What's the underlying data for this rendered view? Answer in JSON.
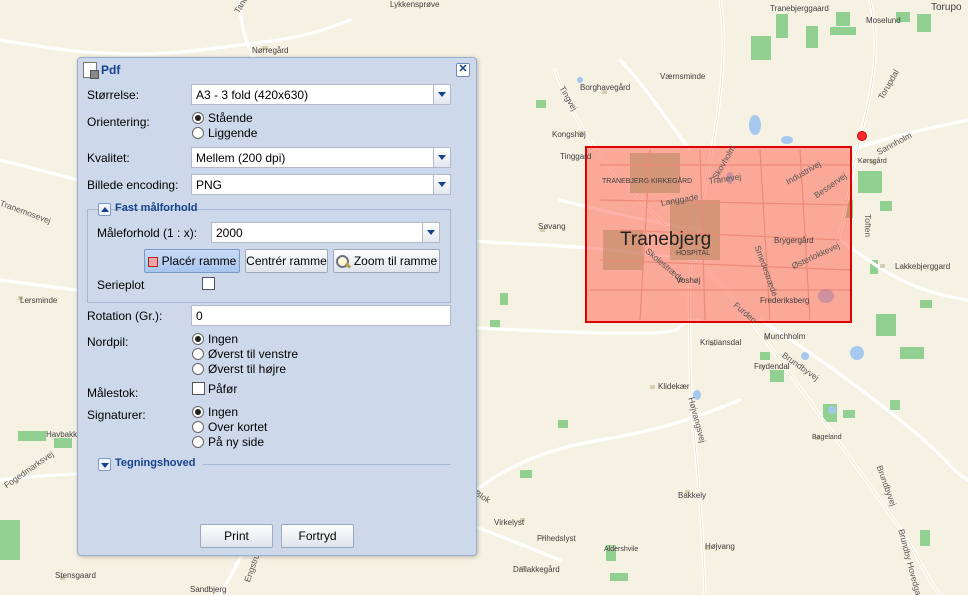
{
  "map": {
    "town": "Tranebjerg",
    "labels": [
      "Tanderupvej",
      "Lykkensprøve",
      "Nørregård",
      "Tranebjerggaard",
      "Moselund",
      "Torupo",
      "Tingvej",
      "Borghavegård",
      "Værnsminde",
      "Torupdal",
      "Sannholm",
      "Kongshøj",
      "Tinggard",
      "Skovholm",
      "Industrivej",
      "Kørsgård",
      "TRANEBJERG KIRKEGÅRD",
      "Tranevej",
      "Besservej",
      "Tranemosevej",
      "Langgade",
      "Søvang",
      "Toften",
      "Brygergård",
      "HOSPITAL",
      "Smedestræde",
      "Østerlokkevej",
      "Lakkebjerggard",
      "Skolestræde",
      "Voshøj",
      "Frederiksberg",
      "Furden",
      "Lersminde",
      "Munchholm",
      "Kristiansdal",
      "Brundbyvej",
      "Frydendal",
      "Klidekær",
      "Højvangsvej",
      "Havbakke",
      "Bageland",
      "Fogedmarksvej",
      "Brundbyvej",
      "Blok",
      "Bakkely",
      "Virkelyst",
      "Frihedslyst",
      "Aldershvile",
      "Højvang",
      "Dallakkegård",
      "Stensgaard",
      "Engstrup",
      "Sandbjerg",
      "Brundby Hovedgade"
    ]
  },
  "dialog": {
    "title": "Pdf",
    "close_label": "✕",
    "size": {
      "label": "Størrelse:",
      "value": "A3 - 3 fold (420x630)"
    },
    "orientation": {
      "label": "Orientering:",
      "options": [
        "Stående",
        "Liggende"
      ],
      "selected": 0
    },
    "quality": {
      "label": "Kvalitet:",
      "value": "Mellem (200 dpi)"
    },
    "encoding": {
      "label": "Billede encoding:",
      "value": "PNG"
    },
    "fixed_scale": {
      "title": "Fast målforhold",
      "ratio_label": "Måleforhold (1 : x):",
      "ratio_value": "2000",
      "place_frame": "Placér ramme",
      "center_frame": "Centrér ramme",
      "zoom_frame": "Zoom til ramme",
      "serieplot_label": "Serieplot",
      "serieplot_checked": false
    },
    "rotation": {
      "label": "Rotation (Gr.):",
      "value": "0"
    },
    "north_arrow": {
      "label": "Nordpil:",
      "options": [
        "Ingen",
        "Øverst til venstre",
        "Øverst til højre"
      ],
      "selected": 0
    },
    "scalebar": {
      "label": "Målestok:",
      "option_label": "Påfør",
      "checked": false
    },
    "legend": {
      "label": "Signaturer:",
      "options": [
        "Ingen",
        "Over kortet",
        "På ny side"
      ],
      "selected": 0
    },
    "drawing_header": {
      "title": "Tegningshoved"
    },
    "print_label": "Print",
    "cancel_label": "Fortryd"
  }
}
